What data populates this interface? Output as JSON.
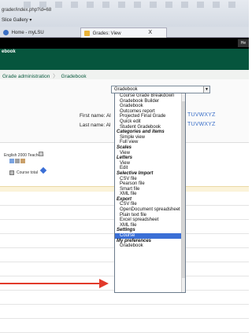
{
  "browser": {
    "url": "grader/index.php?id=68",
    "favorites_label": "Slice Gallery ▾",
    "tabs": [
      {
        "label": "Home - myLSU"
      },
      {
        "label": "Grades: View"
      }
    ],
    "tab_close": "X",
    "header_right": "He"
  },
  "site": {
    "title": "ebook"
  },
  "breadcrumb": {
    "items": [
      "Grade administration",
      "Gradebook"
    ]
  },
  "info": {
    "first_name_label": "First name: Al",
    "last_name_label": "Last name: Al",
    "alphabet_1": "TUVWXYZ",
    "alphabet_2": "TUVWXYZ"
  },
  "grader": {
    "teacher_label": "English 2000 Teachers",
    "course_total_label": "Course total"
  },
  "select": {
    "current": "Gradebook",
    "options": [
      {
        "label": "Course Grade Breakdown",
        "type": "item"
      },
      {
        "label": "Gradebook Builder",
        "type": "item"
      },
      {
        "label": "Gradebook",
        "type": "item"
      },
      {
        "label": "Outcomes report",
        "type": "item"
      },
      {
        "label": "Projected Final Grade",
        "type": "item"
      },
      {
        "label": "Quick edit",
        "type": "item"
      },
      {
        "label": "Student Gradebook",
        "type": "item"
      },
      {
        "label": "Categories and items",
        "type": "group"
      },
      {
        "label": "Simple view",
        "type": "item"
      },
      {
        "label": "Full view",
        "type": "item"
      },
      {
        "label": "Scales",
        "type": "group"
      },
      {
        "label": "View",
        "type": "item"
      },
      {
        "label": "Letters",
        "type": "group"
      },
      {
        "label": "View",
        "type": "item"
      },
      {
        "label": "Edit",
        "type": "item"
      },
      {
        "label": "Selective Import",
        "type": "group"
      },
      {
        "label": "CSV file",
        "type": "item"
      },
      {
        "label": "Pearson file",
        "type": "item"
      },
      {
        "label": "Smart file",
        "type": "item"
      },
      {
        "label": "XML file",
        "type": "item"
      },
      {
        "label": "Export",
        "type": "group"
      },
      {
        "label": "CSV file",
        "type": "item"
      },
      {
        "label": "OpenDocument spreadsheet",
        "type": "item"
      },
      {
        "label": "Plain text file",
        "type": "item"
      },
      {
        "label": "Excel spreadsheet",
        "type": "item"
      },
      {
        "label": "XML file",
        "type": "item"
      },
      {
        "label": "Settings",
        "type": "group"
      },
      {
        "label": "Course",
        "type": "item",
        "selected": true
      },
      {
        "label": "My preferences",
        "type": "group"
      },
      {
        "label": "Gradebook",
        "type": "item"
      }
    ]
  },
  "colors": {
    "header_green": "#06553d",
    "highlight": "#3b6fd6",
    "annotation_arrow": "#e23a2b"
  }
}
